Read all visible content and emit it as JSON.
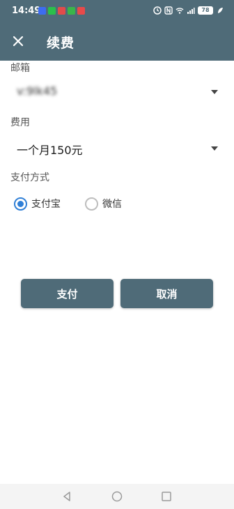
{
  "status_bar": {
    "time": "14:49",
    "battery": "78",
    "apps": [
      {
        "name": "baidu-app-icon",
        "color": "#3d6cf0"
      },
      {
        "name": "wechat-app-icon",
        "color": "#2bbf4b"
      },
      {
        "name": "cloud-app-icon",
        "color": "#e24b4b"
      },
      {
        "name": "green-app-icon",
        "color": "#3ab54a"
      },
      {
        "name": "mail-app-icon",
        "color": "#e84a4a"
      }
    ]
  },
  "app_bar": {
    "title": "续费"
  },
  "form": {
    "email_label": "邮箱",
    "email_value": "v:9lk45",
    "fee_label": "费用",
    "fee_value": "一个月150元",
    "payment_label": "支付方式",
    "payment_options": [
      {
        "label": "支付宝",
        "selected": true
      },
      {
        "label": "微信",
        "selected": false
      }
    ]
  },
  "buttons": {
    "pay_label": "支付",
    "cancel_label": "取消"
  },
  "colors": {
    "primary": "#4f6b78",
    "radio_accent": "#2f7fd6"
  }
}
